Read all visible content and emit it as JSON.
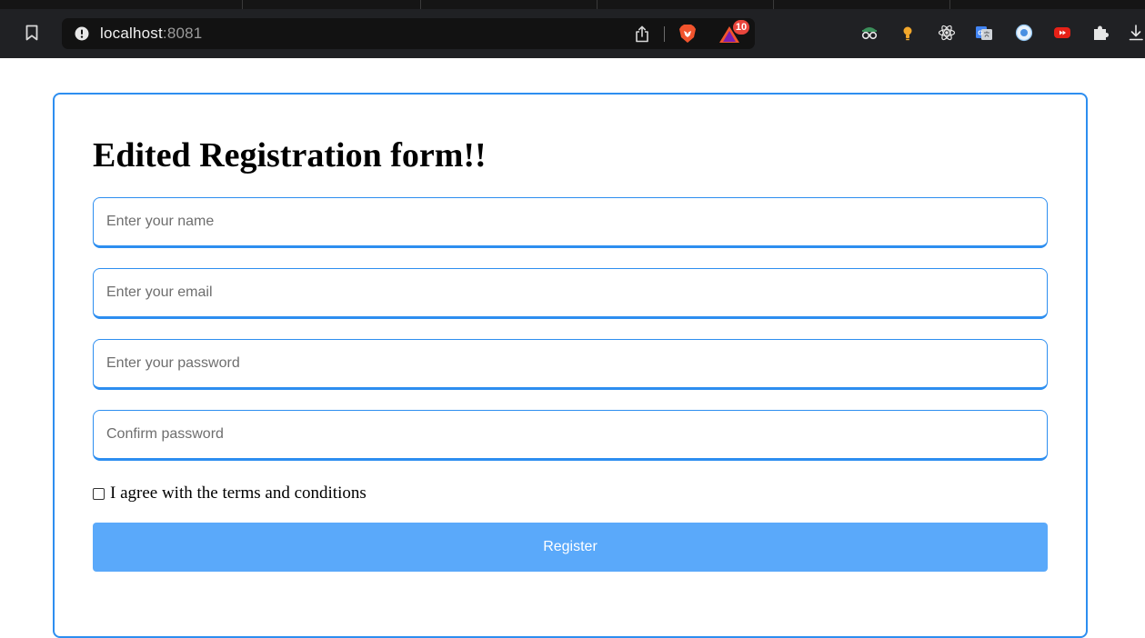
{
  "browser": {
    "url_host": "localhost",
    "url_port": ":8081",
    "rewards_badge_count": "10",
    "extensions": [
      "spy-glasses-icon",
      "lightbulb-icon",
      "react-devtools-icon",
      "google-translate-icon",
      "circle-extension-icon",
      "youtube-forward-icon",
      "puzzle-piece-icon",
      "download-icon"
    ]
  },
  "form": {
    "title": "Edited Registration form!!",
    "name_placeholder": "Enter your name",
    "email_placeholder": "Enter your email",
    "password_placeholder": "Enter your password",
    "confirm_placeholder": "Confirm password",
    "terms_label": "I agree with the terms and conditions",
    "terms_checked": false,
    "register_label": "Register"
  },
  "colors": {
    "accent": "#2d8ef0",
    "button": "#5aa9fa",
    "chrome_bg": "#202124",
    "urlbar_bg": "#121212",
    "badge": "#e8453c"
  }
}
